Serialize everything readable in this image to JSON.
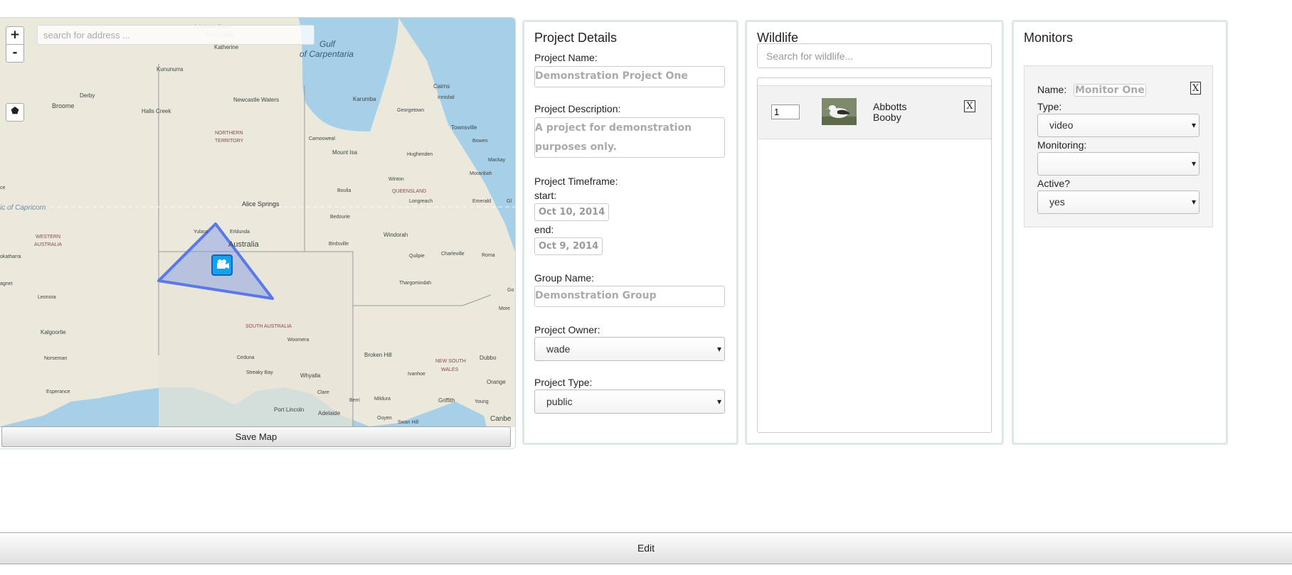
{
  "map": {
    "search_placeholder": "search for address ...",
    "zoom_in": "+",
    "zoom_out": "-",
    "save_button": "Save Map",
    "labels": {
      "gulf": "Gulf",
      "of_carpentaria": "of Carpentaria",
      "katherine": "Katherine",
      "pine_creek": "Pine Creek",
      "adelaide_river": "Adelaide River",
      "kununurra": "Kununurra",
      "derby": "Derby",
      "broome": "Broome",
      "halls_creek": "Halls Creek",
      "newcastle_waters": "Newcastle Waters",
      "northern": "NORTHERN",
      "territory": "TERRITORY",
      "karumba": "Karumba",
      "cairns": "Cairns",
      "innisfail": "Innisfail",
      "georgetown": "Georgetown",
      "townsville": "Townsville",
      "bowen": "Bowen",
      "mackay": "Mackay",
      "camooweal": "Camooweal",
      "mount_isa": "Mount Isa",
      "hughenden": "Hughenden",
      "winton": "Winton",
      "moranbah": "Moranbah",
      "queensland": "QUEENSLAND",
      "longreach": "Longreach",
      "emerald": "Emerald",
      "gladstone": "Gl",
      "boulia": "Boulia",
      "capricorn": "ic of Capricorn",
      "alice_springs": "Alice Springs",
      "bedourie": "Bedourie",
      "windorah": "Windorah",
      "yulara": "Yulara",
      "erldunda": "Erldunda",
      "australia": "Australia",
      "birdsville": "Birdsville",
      "quilpie": "Quilpie",
      "charleville": "Charleville",
      "roma": "Roma",
      "western": "WESTERN",
      "australia_state": "AUSTRALIA",
      "ce": "ce",
      "okatharra": "okatharra",
      "agnet": "agnet",
      "leonora": "Leonora",
      "thargomindah": "Thargomindah",
      "more": "More",
      "go": "Go",
      "kalgoorlie": "Kalgoorlie",
      "south_australia": "SOUTH AUSTRALIA",
      "woomera": "Woomera",
      "broken_hill": "Broken Hill",
      "norseman": "Norseman",
      "ceduna": "Ceduna",
      "new_south": "NEW SOUTH",
      "wales": "WALES",
      "dubbo": "Dubbo",
      "streaky_bay": "Streaky Bay",
      "whyalla": "Whyalla",
      "ivanhoe": "Ivanhoe",
      "orange": "Orange",
      "esperance": "Esperance",
      "clare": "Clare",
      "berri": "Berri",
      "mildura": "Mildura",
      "griffith": "Griffith",
      "young": "Young",
      "port_lincoln": "Port Lincoln",
      "adelaide": "Adelaide",
      "ouyen": "Ouyen",
      "swan_hill": "Swan Hill",
      "canberra": "Canbe"
    }
  },
  "project": {
    "heading": "Project Details",
    "name_label": "Project Name:",
    "name_value": "Demonstration Project One",
    "description_label": "Project Description:",
    "description_value": "A project for demonstration purposes only.",
    "timeframe_label": "Project Timeframe:",
    "start_label": "start:",
    "start_value": "Oct 10, 2014",
    "end_label": "end:",
    "end_value": "Oct 9, 2014",
    "group_label": "Group Name:",
    "group_value": "Demonstration Group",
    "owner_label": "Project Owner:",
    "owner_value": "wade",
    "type_label": "Project Type:",
    "type_value": "public"
  },
  "wildlife": {
    "heading": "Wildlife",
    "search_placeholder": "Search for wildlife...",
    "items": [
      {
        "quantity": "1",
        "name": "Abbotts Booby",
        "remove": "X"
      }
    ]
  },
  "monitors": {
    "heading": "Monitors",
    "items": [
      {
        "name_label": "Name:",
        "name_value": "Monitor One",
        "remove": "X",
        "type_label": "Type:",
        "type_value": "video",
        "monitoring_label": "Monitoring:",
        "monitoring_value": "",
        "active_label": "Active?",
        "active_value": "yes"
      }
    ]
  },
  "footer": {
    "edit_button": "Edit"
  },
  "icons": {
    "caret": "▾",
    "polygon_tool": "⬟"
  }
}
